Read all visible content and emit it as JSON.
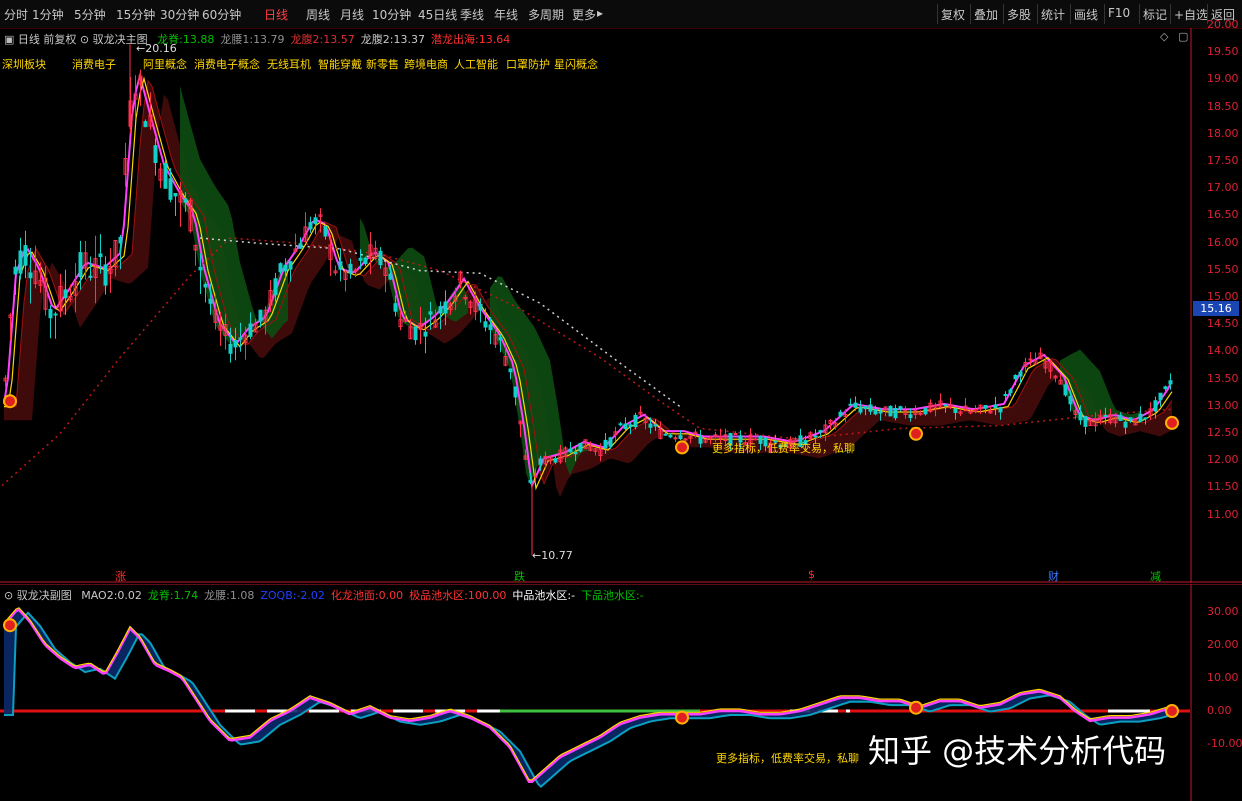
{
  "toolbar": {
    "periods": [
      "分时",
      "1分钟",
      "5分钟",
      "15分钟",
      "30分钟",
      "60分钟",
      "日线",
      "周线",
      "月线",
      "10分钟",
      "45日线",
      "季线",
      "年线",
      "多周期",
      "更多"
    ],
    "active_period": "日线",
    "more_arrow": "▸",
    "actions": [
      "复权",
      "叠加",
      "多股",
      "统计",
      "画线",
      "F10",
      "标记",
      "+自选",
      "返回"
    ]
  },
  "main_chart": {
    "header": {
      "period_label": "日线 前复权",
      "indicator_name": "驭龙决主图",
      "params": [
        {
          "label": "龙脊:",
          "value": "13.88",
          "color": "#00c000"
        },
        {
          "label": "龙腰1:",
          "value": "13.79",
          "color": "#909090"
        },
        {
          "label": "龙腹2:",
          "value": "13.57",
          "color": "#e03030"
        },
        {
          "label": "龙腹2:",
          "value": "13.37",
          "color": "#c8c8c8"
        },
        {
          "label": "潜龙出海:",
          "value": "13.64",
          "color": "#ff3030"
        }
      ]
    },
    "concepts": [
      "深圳板块",
      "消费电子",
      "阿里概念",
      "消费电子概念",
      "无线耳机",
      "智能穿戴",
      "新零售",
      "跨境电商",
      "人工智能",
      "口罩防护",
      "星闪概念"
    ],
    "y_axis": {
      "ticks": [
        "20.00",
        "19.50",
        "19.00",
        "18.50",
        "18.00",
        "17.50",
        "17.00",
        "16.50",
        "16.00",
        "15.50",
        "15.00",
        "14.50",
        "14.00",
        "13.50",
        "13.00",
        "12.50",
        "12.00",
        "11.50",
        "11.00"
      ]
    },
    "current_price": "15.16",
    "high_label": "20.16",
    "low_label": "10.77",
    "ad_text": "更多指标，低费率交易，私聊",
    "bottom_markers": [
      {
        "text": "涨",
        "color": "#ff3030"
      },
      {
        "text": "跌",
        "color": "#00c000"
      },
      {
        "text": "$",
        "color": "#ff3030"
      },
      {
        "text": "财",
        "color": "#3a7cff"
      },
      {
        "text": "减",
        "color": "#00c000"
      }
    ]
  },
  "sub_chart": {
    "header": {
      "indicator_name": "驭龙决副图",
      "params": [
        {
          "label": "MAO2:",
          "value": "0.02",
          "color": "#c8c8c8"
        },
        {
          "label": "龙脊:",
          "value": "1.74",
          "color": "#00c000"
        },
        {
          "label": "龙腰:",
          "value": "1.08",
          "color": "#909090"
        },
        {
          "label": "ZOQB:",
          "value": "-2.02",
          "color": "#2040ff"
        },
        {
          "label": "化龙池面:",
          "value": "0.00",
          "color": "#ff3030"
        },
        {
          "label": "极品池水区:",
          "value": "100.00",
          "color": "#ff3030"
        },
        {
          "label": "中品池水区:",
          "value": "-",
          "color": "#ffffff"
        },
        {
          "label": "下品池水区:",
          "value": "-",
          "color": "#00c000"
        }
      ]
    },
    "y_axis": {
      "ticks": [
        "30.00",
        "20.00",
        "10.00",
        "0.00",
        "-10.00"
      ]
    },
    "ad_text": "更多指标，低费率交易，私聊"
  },
  "watermark": "知乎 @技术分析代码",
  "colors": {
    "bg": "#000000",
    "axis": "#c0182b",
    "up": "#ff3030",
    "down": "#00d0c0",
    "green_band": "#0f5a0f",
    "red_band": "#5a0e0e"
  }
}
